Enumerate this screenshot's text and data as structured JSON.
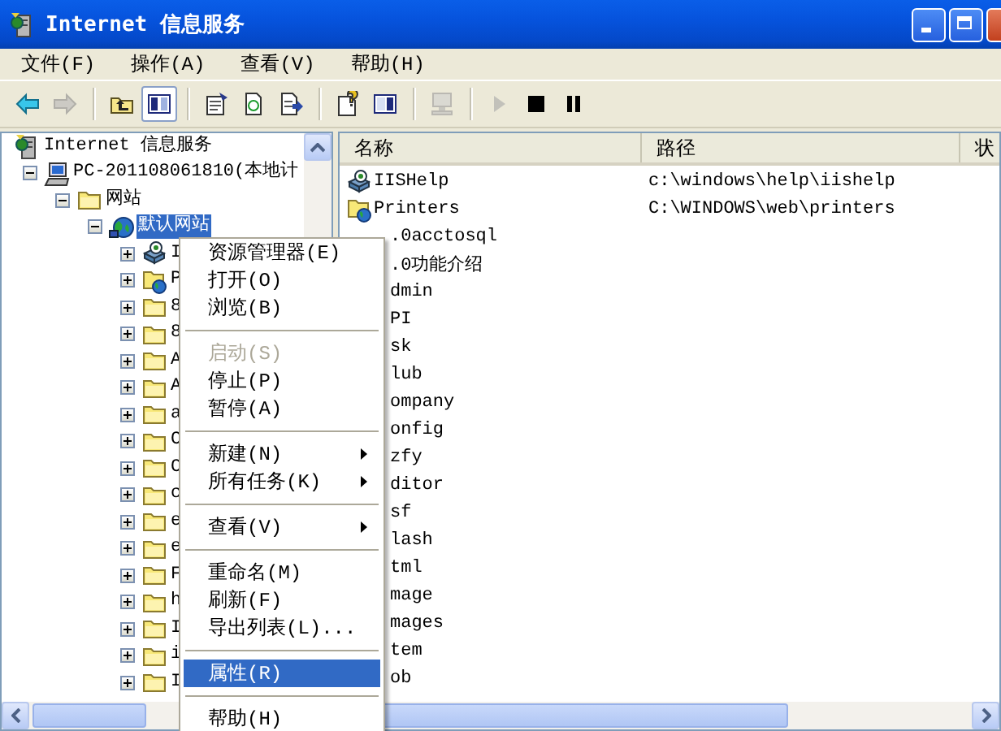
{
  "window": {
    "title": "Internet 信息服务"
  },
  "menu": [
    "文件(F)",
    "操作(A)",
    "查看(V)",
    "帮助(H)"
  ],
  "toolbar": [
    {
      "kind": "back",
      "disabled": false,
      "pressed": false
    },
    {
      "kind": "forward",
      "disabled": true,
      "pressed": false
    },
    {
      "kind": "separator"
    },
    {
      "kind": "up",
      "disabled": false,
      "pressed": false
    },
    {
      "kind": "tree",
      "disabled": false,
      "pressed": true
    },
    {
      "kind": "separator"
    },
    {
      "kind": "props",
      "disabled": false,
      "pressed": false
    },
    {
      "kind": "refresh",
      "disabled": false,
      "pressed": false
    },
    {
      "kind": "export",
      "disabled": false,
      "pressed": false
    },
    {
      "kind": "separator"
    },
    {
      "kind": "help",
      "disabled": false,
      "pressed": false
    },
    {
      "kind": "pane",
      "disabled": false,
      "pressed": false
    },
    {
      "kind": "separator"
    },
    {
      "kind": "computer",
      "disabled": true,
      "pressed": false
    },
    {
      "kind": "separator"
    },
    {
      "kind": "play",
      "disabled": true,
      "pressed": false
    },
    {
      "kind": "stop",
      "disabled": false,
      "pressed": false
    },
    {
      "kind": "pause",
      "disabled": false,
      "pressed": false
    }
  ],
  "tree": [
    {
      "label": "Internet 信息服务",
      "kind": "iis",
      "selected": false,
      "children": [
        {
          "label": "PC-201108061810(本地计",
          "kind": "computer",
          "expanded": true,
          "selected": false,
          "children": [
            {
              "label": "网站",
              "kind": "folder",
              "expanded": true,
              "selected": false,
              "children": [
                {
                  "label": "默认网站",
                  "kind": "site",
                  "expanded": true,
                  "selected": true,
                  "children": [
                    {
                      "label": "I",
                      "kind": "app",
                      "expanded": false,
                      "selected": false
                    },
                    {
                      "label": "P",
                      "kind": "webfolder",
                      "expanded": false,
                      "selected": false
                    },
                    {
                      "label": "8",
                      "kind": "folder",
                      "expanded": false,
                      "selected": false
                    },
                    {
                      "label": "8",
                      "kind": "folder",
                      "expanded": false,
                      "selected": false
                    },
                    {
                      "label": "A",
                      "kind": "folder",
                      "expanded": false,
                      "selected": false
                    },
                    {
                      "label": "A",
                      "kind": "folder",
                      "expanded": false,
                      "selected": false
                    },
                    {
                      "label": "a",
                      "kind": "folder",
                      "expanded": false,
                      "selected": false
                    },
                    {
                      "label": "C",
                      "kind": "folder",
                      "expanded": false,
                      "selected": false
                    },
                    {
                      "label": "C",
                      "kind": "folder",
                      "expanded": false,
                      "selected": false
                    },
                    {
                      "label": "c",
                      "kind": "folder",
                      "expanded": false,
                      "selected": false
                    },
                    {
                      "label": "e",
                      "kind": "folder",
                      "expanded": false,
                      "selected": false
                    },
                    {
                      "label": "e",
                      "kind": "folder",
                      "expanded": false,
                      "selected": false
                    },
                    {
                      "label": "F",
                      "kind": "folder",
                      "expanded": false,
                      "selected": false
                    },
                    {
                      "label": "h",
                      "kind": "folder",
                      "expanded": false,
                      "selected": false
                    },
                    {
                      "label": "I",
                      "kind": "folder",
                      "expanded": false,
                      "selected": false
                    },
                    {
                      "label": "i",
                      "kind": "folder",
                      "expanded": false,
                      "selected": false
                    },
                    {
                      "label": "I",
                      "kind": "folder",
                      "expanded": false,
                      "selected": false
                    }
                  ]
                }
              ]
            }
          ]
        }
      ]
    }
  ],
  "list": {
    "columns": [
      "名称",
      "路径",
      "状"
    ],
    "rows": [
      {
        "kind": "app",
        "name": "IISHelp",
        "path": "c:\\windows\\help\\iishelp"
      },
      {
        "kind": "webfolder",
        "name": "Printers",
        "path": "C:\\WINDOWS\\web\\printers"
      },
      {
        "name": ".0acctosql"
      },
      {
        "name": ".0功能介绍"
      },
      {
        "name": "dmin"
      },
      {
        "name": "PI"
      },
      {
        "name": "sk"
      },
      {
        "name": "lub"
      },
      {
        "name": "ompany"
      },
      {
        "name": "onfig"
      },
      {
        "name": "zfy"
      },
      {
        "name": "ditor"
      },
      {
        "name": "sf"
      },
      {
        "name": "lash"
      },
      {
        "name": "tml"
      },
      {
        "name": "mage"
      },
      {
        "name": "mages"
      },
      {
        "name": "tem"
      },
      {
        "name": "ob"
      }
    ]
  },
  "context_menu": [
    {
      "kind": "item",
      "label": "资源管理器(E)",
      "disabled": false,
      "selected": false,
      "submenu": false
    },
    {
      "kind": "item",
      "label": "打开(O)",
      "disabled": false,
      "selected": false,
      "submenu": false
    },
    {
      "kind": "item",
      "label": "浏览(B)",
      "disabled": false,
      "selected": false,
      "submenu": false
    },
    {
      "kind": "separator"
    },
    {
      "kind": "item",
      "label": "启动(S)",
      "disabled": true,
      "selected": false,
      "submenu": false
    },
    {
      "kind": "item",
      "label": "停止(P)",
      "disabled": false,
      "selected": false,
      "submenu": false
    },
    {
      "kind": "item",
      "label": "暂停(A)",
      "disabled": false,
      "selected": false,
      "submenu": false
    },
    {
      "kind": "separator"
    },
    {
      "kind": "item",
      "label": "新建(N)",
      "disabled": false,
      "selected": false,
      "submenu": true
    },
    {
      "kind": "item",
      "label": "所有任务(K)",
      "disabled": false,
      "selected": false,
      "submenu": true
    },
    {
      "kind": "separator"
    },
    {
      "kind": "item",
      "label": "查看(V)",
      "disabled": false,
      "selected": false,
      "submenu": true
    },
    {
      "kind": "separator"
    },
    {
      "kind": "item",
      "label": "重命名(M)",
      "disabled": false,
      "selected": false,
      "submenu": false
    },
    {
      "kind": "item",
      "label": "刷新(F)",
      "disabled": false,
      "selected": false,
      "submenu": false
    },
    {
      "kind": "item",
      "label": "导出列表(L)...",
      "disabled": false,
      "selected": false,
      "submenu": false
    },
    {
      "kind": "separator"
    },
    {
      "kind": "item",
      "label": "属性(R)",
      "disabled": false,
      "selected": true,
      "submenu": false
    },
    {
      "kind": "separator"
    },
    {
      "kind": "item",
      "label": "帮助(H)",
      "disabled": false,
      "selected": false,
      "submenu": false
    }
  ]
}
